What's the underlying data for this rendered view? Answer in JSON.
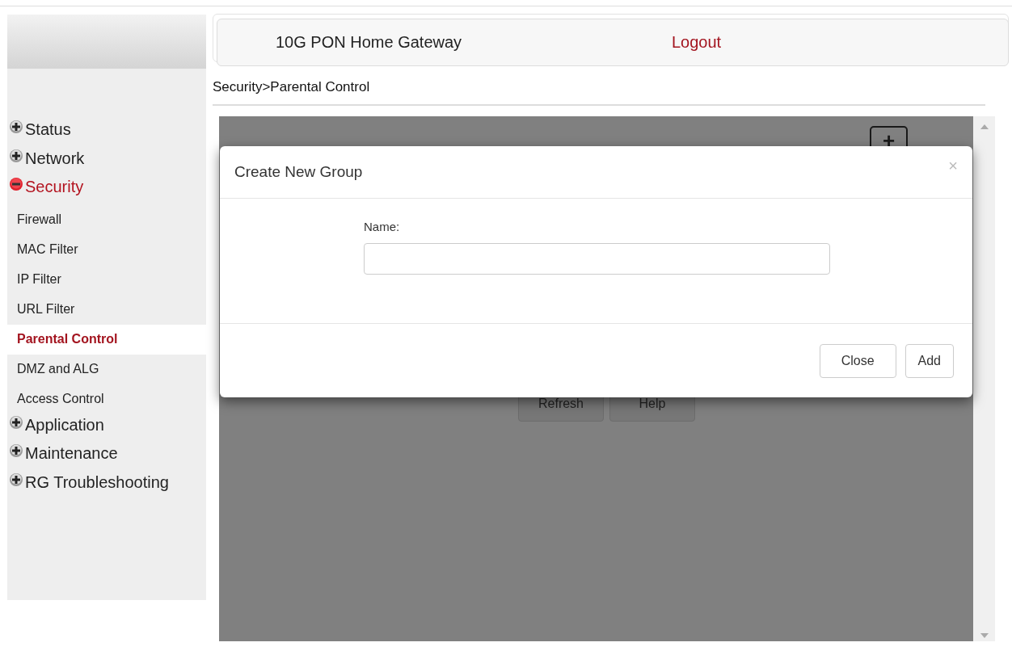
{
  "header": {
    "title": "10G PON Home Gateway",
    "logout": "Logout"
  },
  "breadcrumb": "Security>Parental Control",
  "sidebar": {
    "items": [
      {
        "label": "Status",
        "expanded": false
      },
      {
        "label": "Network",
        "expanded": false
      },
      {
        "label": "Security",
        "expanded": true,
        "children": [
          {
            "label": "Firewall",
            "selected": false
          },
          {
            "label": "MAC Filter",
            "selected": false
          },
          {
            "label": "IP Filter",
            "selected": false
          },
          {
            "label": "URL Filter",
            "selected": false
          },
          {
            "label": "Parental Control",
            "selected": true
          },
          {
            "label": "DMZ and ALG",
            "selected": false
          },
          {
            "label": "Access Control",
            "selected": false
          }
        ]
      },
      {
        "label": "Application",
        "expanded": false
      },
      {
        "label": "Maintenance",
        "expanded": false
      },
      {
        "label": "RG Troubleshooting",
        "expanded": false
      }
    ]
  },
  "page": {
    "add_symbol": "+",
    "buttons": [
      "Refresh",
      "Help"
    ]
  },
  "dialog": {
    "title": "Create New Group",
    "close_symbol": "×",
    "field_label": "Name:",
    "buttons": [
      "Close",
      "Add"
    ]
  }
}
